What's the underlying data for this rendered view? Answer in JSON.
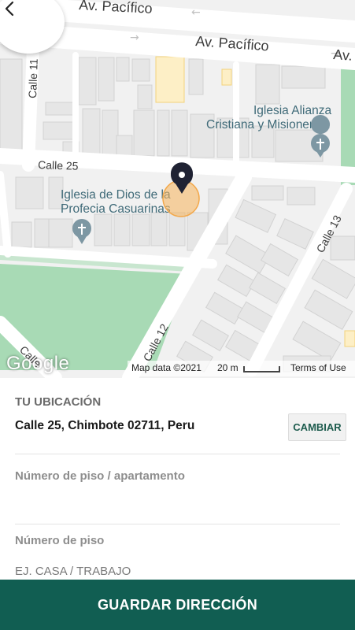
{
  "map": {
    "streets": {
      "pacifico_top": "Av. Pacífico",
      "pacifico_main": "Av. Pacífico",
      "pacifico_right": "Av.",
      "calle_11": "Calle 11",
      "calle_25": "Calle 25",
      "calle_13": "Calle 13",
      "calle_12": "Calle 12",
      "calle_left": "Calle"
    },
    "places": {
      "iglesia_alianza_1": "Iglesia Alianza",
      "iglesia_alianza_2": "Cristiana y Misionera...",
      "iglesia_dios_1": "Iglesia de Dios de la",
      "iglesia_dios_2": "Profecia Casuarinas"
    },
    "google_logo": "Google",
    "map_data": "Map data ©2021",
    "scale": "20 m",
    "terms": "Terms of Use"
  },
  "form": {
    "location_label": "TU UBICACIÓN",
    "address": "Calle 25, Chimbote 02711, Peru",
    "change_button": "CAMBIAR",
    "floor_apartment_label": "Número de piso / apartamento",
    "floor_apartment_value": "",
    "floor_label": "Número de piso",
    "floor_placeholder": "EJ. CASA / TRABAJO"
  },
  "save_button": "GUARDAR DIRECCIÓN",
  "colors": {
    "primary": "#115e52",
    "accent_text": "#1e5c4e",
    "marker": "#1f2233",
    "marker_halo": "#f5b35a",
    "park": "#a8dab5"
  }
}
